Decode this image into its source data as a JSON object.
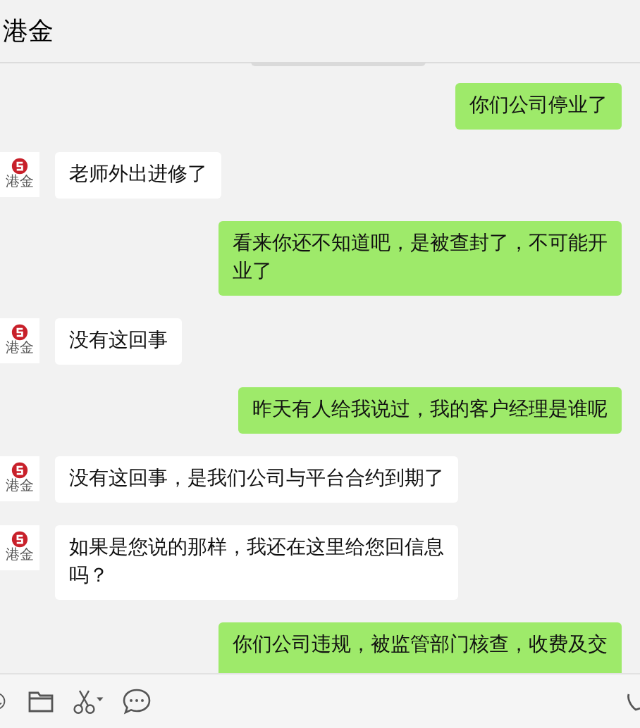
{
  "header": {
    "title": "港金"
  },
  "messages": [
    {
      "kind": "sent",
      "text": "你们公司停业了"
    },
    {
      "kind": "received",
      "avatar_label": "港金",
      "text": "老师外出进修了"
    },
    {
      "kind": "sent",
      "text": "看来你还不知道吧，是被查封了，不可能开业了"
    },
    {
      "kind": "received",
      "avatar_label": "港金",
      "text": "没有这回事"
    },
    {
      "kind": "sent",
      "text": "昨天有人给我说过，我的客户经理是谁呢"
    },
    {
      "kind": "received",
      "avatar_label": "港金",
      "text": "没有这回事，是我们公司与平台合约到期了"
    },
    {
      "kind": "received",
      "avatar_label": "港金",
      "text": "如果是您说的那样，我还在这里给您回信息吗？"
    },
    {
      "kind": "sent",
      "text": "你们公司违规，被监管部门核查，收费及交"
    }
  ]
}
